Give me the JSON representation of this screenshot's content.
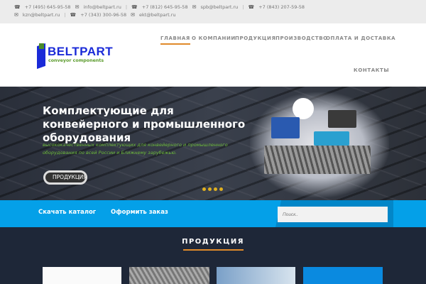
{
  "topbar": {
    "row1": [
      {
        "icon": "phone-icon",
        "text": "+7 (495) 645-95-58"
      },
      {
        "icon": "mail-icon",
        "text": "info@beltpart.ru"
      },
      {
        "icon": "phone-icon",
        "text": "+7 (812) 645-95-58"
      },
      {
        "icon": "mail-icon",
        "text": "spb@beltpart.ru"
      },
      {
        "icon": "phone-icon",
        "text": "+7 (843) 207-59-58"
      }
    ],
    "row2": [
      {
        "icon": "mail-icon",
        "text": "kzn@beltpart.ru"
      },
      {
        "icon": "phone-icon",
        "text": "+7 (343) 300-96-58"
      },
      {
        "icon": "mail-icon",
        "text": "ekt@beltpart.ru"
      }
    ],
    "separator": "|"
  },
  "logo": {
    "name": "BELTPART",
    "tagline": "conveyor components"
  },
  "nav": [
    "ГЛАВНАЯ",
    "О КОМПАНИИ",
    "ПРОДУКЦИЯ",
    "ПРОИЗВОДСТВО",
    "ОПЛАТА И ДОСТАВКА",
    "КОНТАКТЫ"
  ],
  "hero": {
    "title": "Комплектующие для конвейерного и промышленного оборудования",
    "subtitle": "высококачественных комплектующих для конвейерного и промышленного оборудования по всей России и Ближнему зарубежью.",
    "button": "ПРОДУКЦИЯ",
    "slides": 4
  },
  "actions": {
    "catalog": "Скачать каталог",
    "order": "Оформить заказ",
    "search_placeholder": "Поиск.."
  },
  "products": {
    "title": "ПРОДУКЦИЯ"
  },
  "colors": {
    "accent": "#e08a2a",
    "blue": "#04a0e8",
    "dark": "#1e2738",
    "brand": "#1a2ad8",
    "green": "#6dbb3a"
  }
}
